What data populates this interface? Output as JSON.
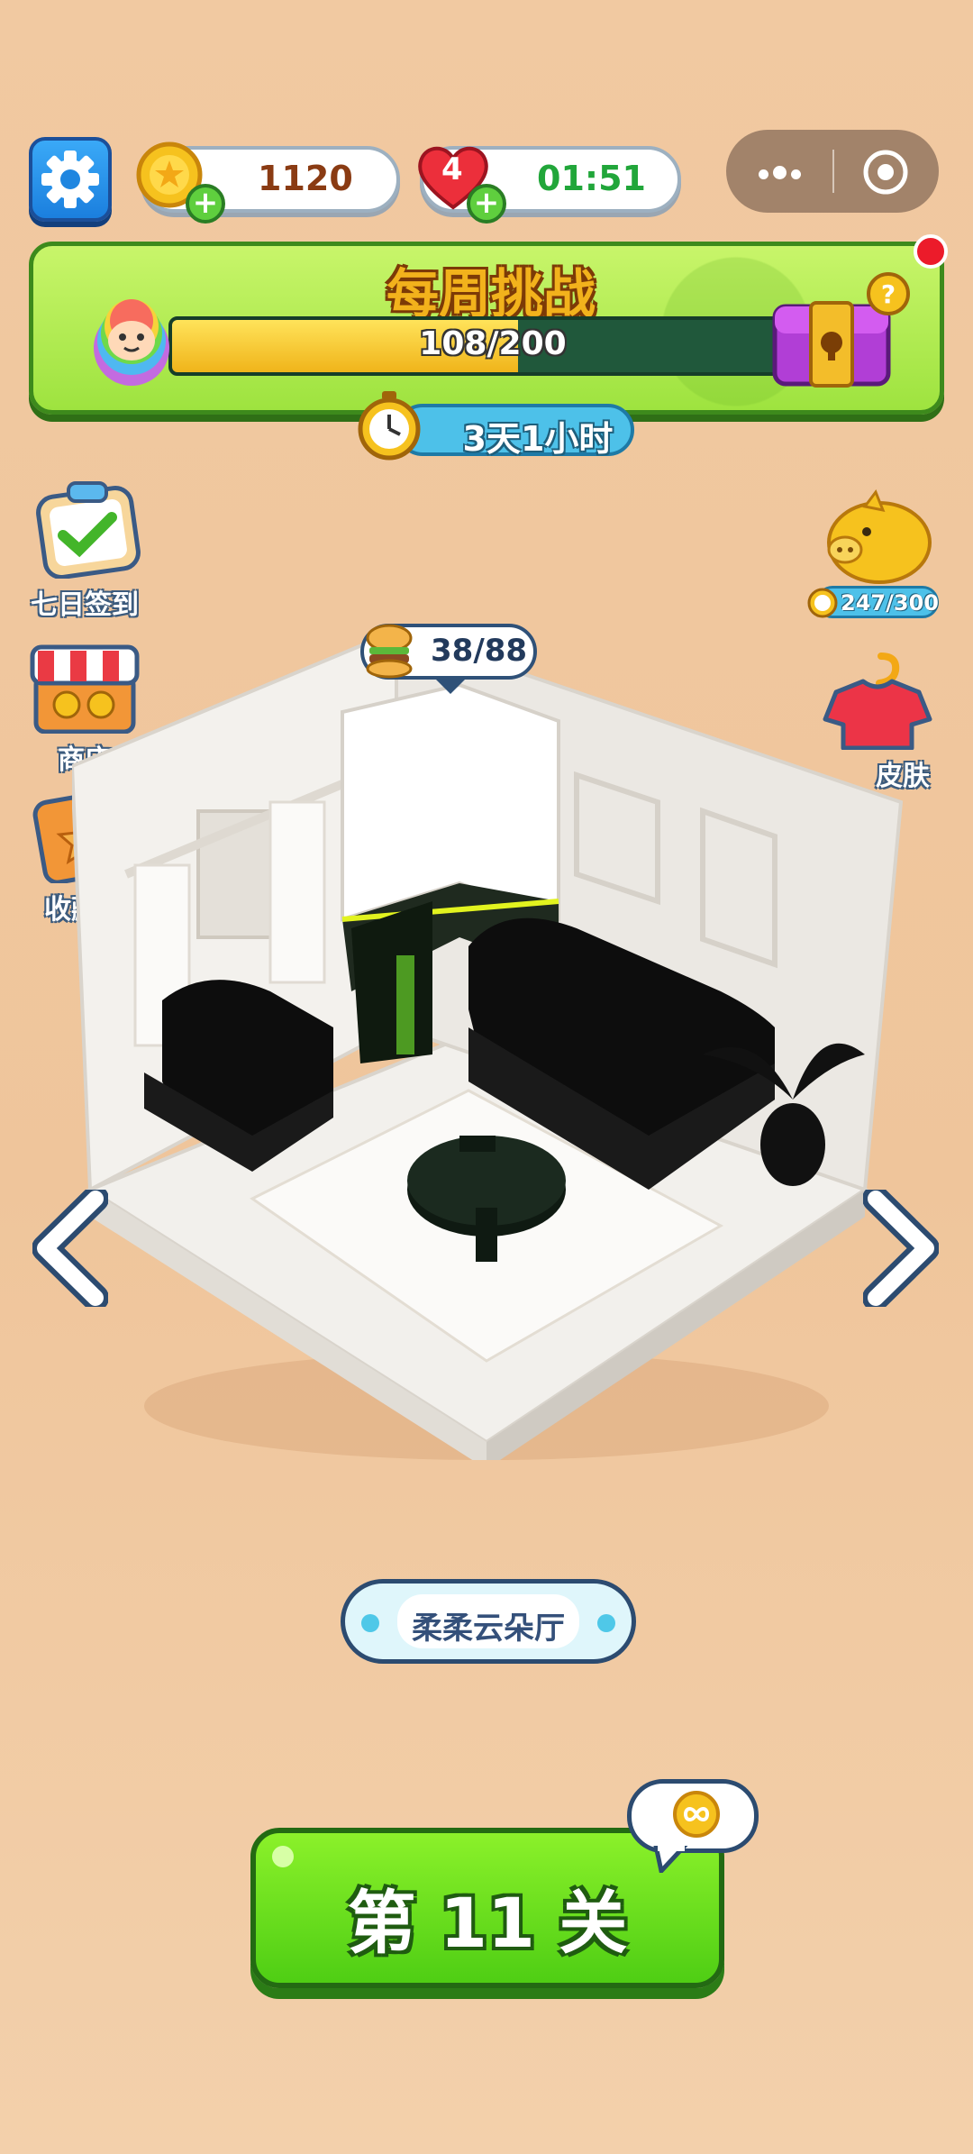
{
  "header": {
    "coins": "1120",
    "lives": "4",
    "life_timer": "01:51"
  },
  "weekly_challenge": {
    "title": "每周挑战",
    "progress_text": "108/200",
    "progress_fraction": 0.54,
    "time_left": "3天1小时"
  },
  "left_menu": [
    {
      "label": "七日签到"
    },
    {
      "label": "商店"
    },
    {
      "label": "收藏册"
    }
  ],
  "right_menu": {
    "piggy_progress": "247/300",
    "skin_label": "皮肤"
  },
  "room": {
    "items_counter": "38/88",
    "name": "柔柔云朵厅"
  },
  "play": {
    "label": "第 11 关"
  }
}
